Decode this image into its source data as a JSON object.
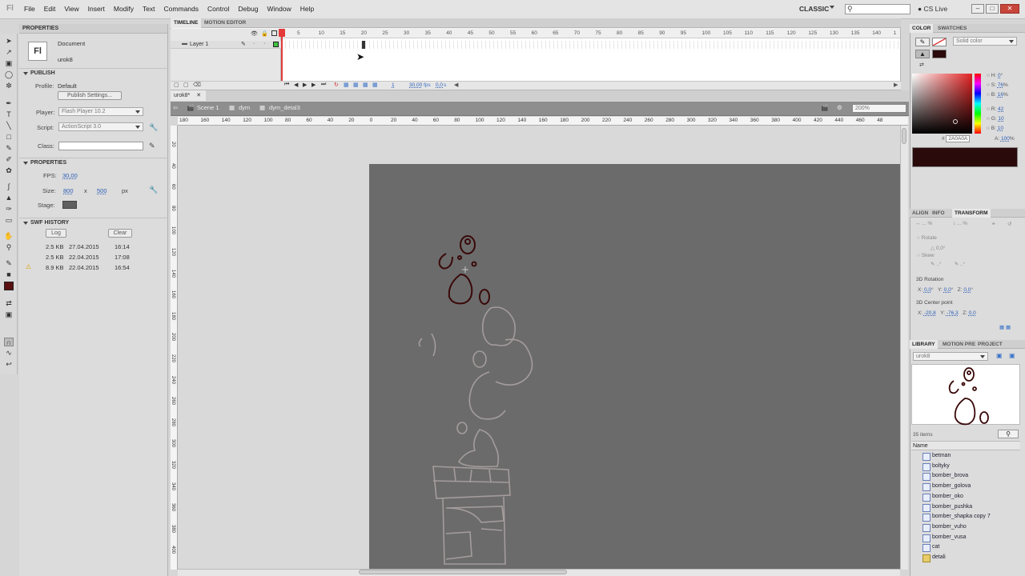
{
  "menu": [
    "File",
    "Edit",
    "View",
    "Insert",
    "Modify",
    "Text",
    "Commands",
    "Control",
    "Debug",
    "Window",
    "Help"
  ],
  "workspace": "CLASSIC",
  "cs_live": "CS Live",
  "app_logo": "Fl",
  "properties": {
    "tab": "PROPERTIES",
    "doc_icon": "Fl",
    "doc_type": "Document",
    "doc_name": "urok8",
    "publish_header": "PUBLISH",
    "profile_label": "Profile:",
    "profile_value": "Default",
    "publish_settings": "Publish Settings...",
    "player_label": "Player:",
    "player_value": "Flash Player 10.2",
    "script_label": "Script:",
    "script_value": "ActionScript 3.0",
    "class_label": "Class:",
    "props_header": "PROPERTIES",
    "fps_label": "FPS:",
    "fps_value": "30,00",
    "size_label": "Size:",
    "width": "800",
    "x": "x",
    "height": "500",
    "unit": "px",
    "stage_label": "Stage:",
    "stage_color": "#5f5f5f",
    "swf_header": "SWF HISTORY",
    "log_btn": "Log",
    "clear_btn": "Clear",
    "history": [
      {
        "size": "2.5 KB",
        "date": "27.04.2015",
        "time": "16:14"
      },
      {
        "size": "2.5 KB",
        "date": "22.04.2015",
        "time": "17:08"
      },
      {
        "size": "8.9 KB",
        "date": "22.04.2015",
        "time": "16:54"
      }
    ]
  },
  "timeline": {
    "tab_timeline": "TIMELINE",
    "tab_motion": "MOTION EDITOR",
    "layer": "Layer 1",
    "frames": [
      "5",
      "10",
      "15",
      "20",
      "25",
      "30",
      "35",
      "40",
      "45",
      "50",
      "55",
      "60",
      "65",
      "70",
      "75",
      "80",
      "85",
      "90",
      "95",
      "100",
      "105",
      "110",
      "115",
      "120",
      "125",
      "130",
      "135",
      "140",
      "1"
    ],
    "current_frame": "1",
    "fps": "30,00",
    "fps_unit": "fps",
    "time": "0,0",
    "time_unit": "s"
  },
  "document": {
    "tab": "urok8*",
    "crumbs": [
      "Scene 1",
      "dym",
      "dym_detal3"
    ],
    "zoom": "200%",
    "hruler": [
      "180",
      "160",
      "140",
      "120",
      "100",
      "80",
      "60",
      "40",
      "20",
      "0",
      "20",
      "40",
      "60",
      "80",
      "100",
      "120",
      "140",
      "160",
      "180",
      "200",
      "220",
      "240",
      "260",
      "280",
      "300",
      "320",
      "340",
      "360",
      "380",
      "400",
      "420",
      "440",
      "460",
      "48"
    ],
    "vruler": [
      "20",
      "40",
      "60",
      "80",
      "100",
      "120",
      "140",
      "160",
      "180",
      "200",
      "220",
      "240",
      "260",
      "280",
      "300",
      "320",
      "340",
      "360",
      "380",
      "400"
    ]
  },
  "color": {
    "tab_color": "COLOR",
    "tab_swatches": "SWATCHES",
    "type": "Solid color",
    "h_label": "H:",
    "h": "0",
    "s_label": "S:",
    "s": "76",
    "b_label": "B:",
    "b": "16",
    "r_label": "R:",
    "r": "42",
    "g_label": "G:",
    "g": "10",
    "bl_label": "B:",
    "bl": "10",
    "hex": "2A0A0A",
    "alpha_label": "A:",
    "alpha": "100",
    "deg": "°",
    "pct": "%"
  },
  "transform": {
    "tabs": [
      "ALIGN",
      "INFO",
      "TRANSFORM"
    ],
    "rotate": "Rotate",
    "rotate_value": "0,0",
    "skew": "Skew",
    "rot3d": "3D Rotation",
    "rx": "0,0",
    "ry": "0,0",
    "rz": "0,0",
    "center3d": "3D Center point",
    "cx": "-20,8",
    "cy": "-76,3",
    "cz": "0,0",
    "x_label": "X:",
    "y_label": "Y:",
    "z_label": "Z:"
  },
  "library": {
    "tabs": [
      "LIBRARY",
      "MOTION PRE",
      "PROJECT"
    ],
    "doc": "urok8",
    "count": "35 items",
    "name_col": "Name",
    "items": [
      {
        "name": "betman",
        "folder": false
      },
      {
        "name": "boltyky",
        "folder": false
      },
      {
        "name": "bomber_brova",
        "folder": false
      },
      {
        "name": "bomber_golova",
        "folder": false
      },
      {
        "name": "bomber_oko",
        "folder": false
      },
      {
        "name": "bomber_pushka",
        "folder": false
      },
      {
        "name": "bomber_shapka copy 7",
        "folder": false
      },
      {
        "name": "bomber_vuho",
        "folder": false
      },
      {
        "name": "bomber_vusa",
        "folder": false
      },
      {
        "name": "cat",
        "folder": false
      },
      {
        "name": "detali",
        "folder": true
      }
    ]
  }
}
